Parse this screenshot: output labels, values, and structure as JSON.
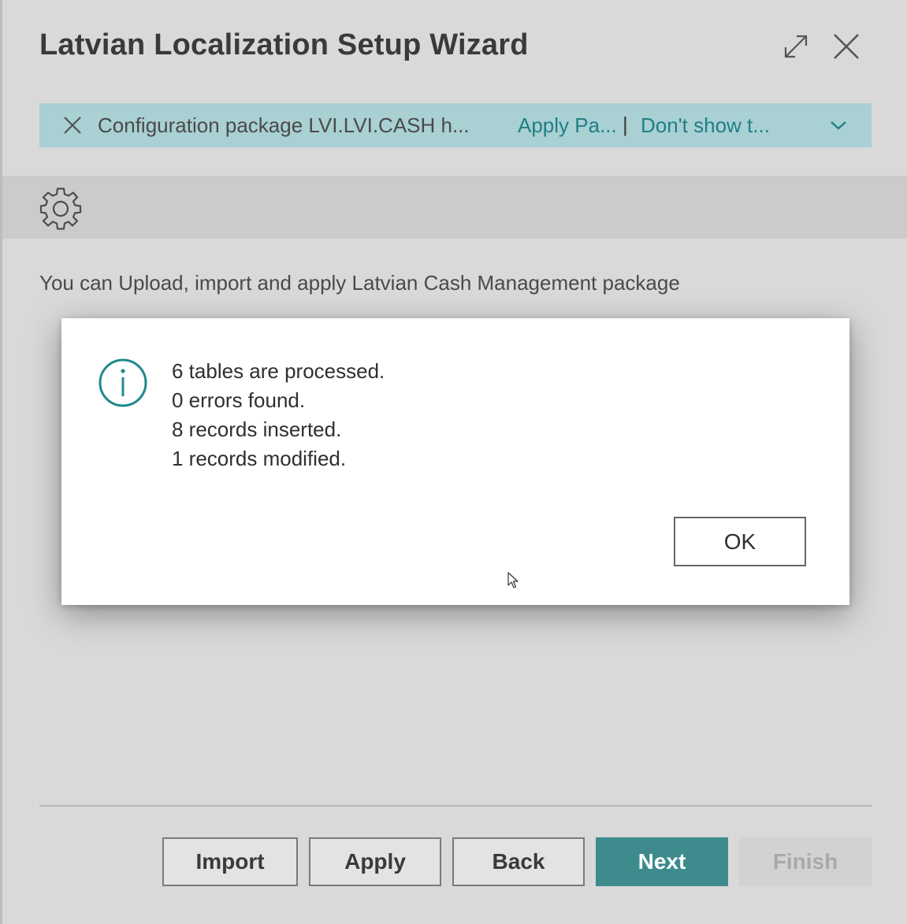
{
  "window": {
    "title": "Latvian Localization Setup Wizard",
    "expand_icon": "expand-icon",
    "close_icon": "close-icon"
  },
  "notification": {
    "message": "Configuration package LVI.LVI.CASH h...",
    "action_apply": "Apply Pa...",
    "separator": "|",
    "action_dont_show": "Don't show t...",
    "bar_color": "#a9d0d3",
    "link_color": "#1f7f86"
  },
  "actionbar": {
    "settings_icon": "gear-icon"
  },
  "body": {
    "description": "You can Upload, import and apply Latvian Cash Management package"
  },
  "dialog": {
    "icon": "info-icon",
    "lines": [
      "6 tables are processed.",
      "0 errors found.",
      "8 records inserted.",
      "1 records modified."
    ],
    "ok_label": "OK"
  },
  "footer": {
    "import_label": "Import",
    "apply_label": "Apply",
    "back_label": "Back",
    "next_label": "Next",
    "finish_label": "Finish",
    "accent_color": "#3e8b8d"
  }
}
